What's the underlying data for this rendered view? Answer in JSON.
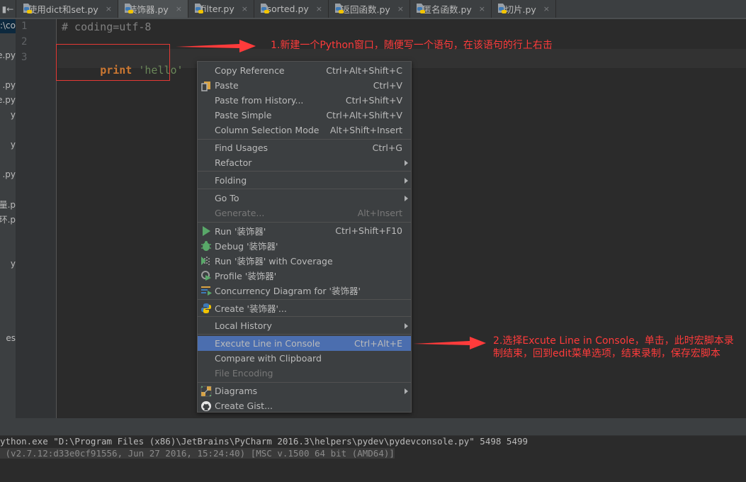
{
  "tabbar": {
    "left_toggle_icon": "collapse-left-icon",
    "tabs": [
      {
        "label": "使用dict和set.py",
        "close": "×",
        "active": false
      },
      {
        "label": "装饰器.py",
        "close": "×",
        "active": true
      },
      {
        "label": "filter.py",
        "close": "×",
        "active": false
      },
      {
        "label": "sorted.py",
        "close": "×",
        "active": false
      },
      {
        "label": "返回函数.py",
        "close": "×",
        "active": false
      },
      {
        "label": "匿名函数.py",
        "close": "×",
        "active": false
      },
      {
        "label": "切片.py",
        "close": "×",
        "active": false
      }
    ]
  },
  "project": {
    "items": [
      ":\\co",
      "e.py",
      ".py",
      "e.py",
      "y",
      "y",
      ".py",
      "量.p",
      "环.p",
      "y",
      "es"
    ]
  },
  "editor": {
    "line_numbers": [
      "1",
      "2",
      "3"
    ],
    "lines": {
      "comment": "# coding=utf-8",
      "keyword": "print",
      "string": "'hello'"
    }
  },
  "annotations": {
    "step1": "1.新建一个Python窗口，随便写一个语句，在该语句的行上右击",
    "step2": "2.选择Excute Line in Console，单击，此时宏脚本录制结束，回到edit菜单选项，结束录制，保存宏脚本",
    "color": "#ff3b3b"
  },
  "context_menu": {
    "items": [
      {
        "label": "Copy Reference",
        "shortcut": "Ctrl+Alt+Shift+C"
      },
      {
        "label": "Paste",
        "shortcut": "Ctrl+V",
        "icon": "paste-icon"
      },
      {
        "label": "Paste from History...",
        "shortcut": "Ctrl+Shift+V"
      },
      {
        "label": "Paste Simple",
        "shortcut": "Ctrl+Alt+Shift+V"
      },
      {
        "label": "Column Selection Mode",
        "shortcut": "Alt+Shift+Insert"
      },
      {
        "label": "Find Usages",
        "shortcut": "Ctrl+G"
      },
      {
        "label": "Refactor",
        "submenu": true
      },
      {
        "label": "Folding",
        "submenu": true
      },
      {
        "label": "Go To",
        "submenu": true
      },
      {
        "label": "Generate...",
        "shortcut": "Alt+Insert",
        "disabled": true
      },
      {
        "label": "Run '装饰器'",
        "shortcut": "Ctrl+Shift+F10",
        "icon": "run-icon"
      },
      {
        "label": "Debug '装饰器'",
        "icon": "debug-icon"
      },
      {
        "label": "Run '装饰器' with Coverage",
        "icon": "coverage-icon"
      },
      {
        "label": "Profile '装饰器'",
        "icon": "profile-icon"
      },
      {
        "label": "Concurrency Diagram for  '装饰器'",
        "icon": "concurrency-icon"
      },
      {
        "label": "Create '装饰器'...",
        "icon": "python-icon"
      },
      {
        "label": "Local History",
        "submenu": true
      },
      {
        "label": "Execute Line in Console",
        "shortcut": "Ctrl+Alt+E",
        "selected": true
      },
      {
        "label": "Compare with Clipboard"
      },
      {
        "label": "File Encoding",
        "disabled": true
      },
      {
        "label": "Diagrams",
        "submenu": true,
        "icon": "diagrams-icon"
      },
      {
        "label": "Create Gist...",
        "icon": "github-icon"
      }
    ],
    "selected_color": "#4b6eaf"
  },
  "console": {
    "line1": "ython.exe \"D:\\Program Files (x86)\\JetBrains\\PyCharm 2016.3\\helpers\\pydev\\pydevconsole.py\" 5498 5499",
    "line2": " (v2.7.12:d33e0cf91556, Jun 27 2016, 15:24:40) [MSC v.1500 64 bit (AMD64)]"
  }
}
